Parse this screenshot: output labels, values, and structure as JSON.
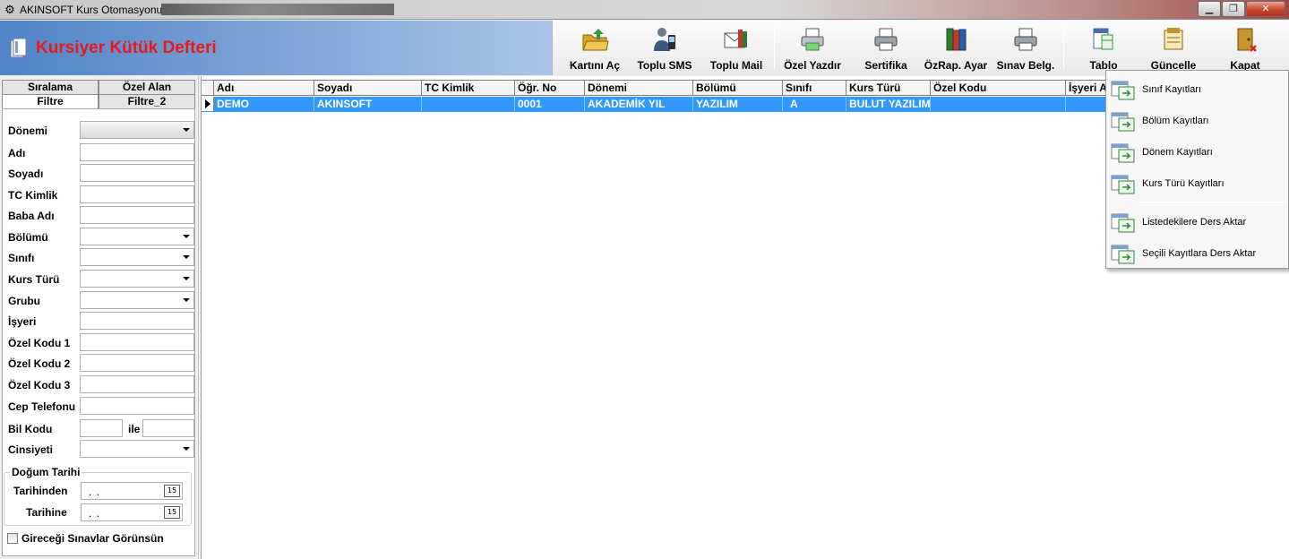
{
  "window": {
    "title": "AKINSOFT Kurs Otomasyonu s",
    "controls": [
      "minimize",
      "maximize",
      "close"
    ]
  },
  "header": {
    "title": "Kursiyer Kütük Defteri"
  },
  "toolbar": {
    "buttons": [
      {
        "label": "Kartını Aç",
        "icon": "folder-open-icon"
      },
      {
        "label": "Toplu SMS",
        "icon": "phone-person-icon"
      },
      {
        "label": "Toplu Mail",
        "icon": "mail-books-icon"
      },
      {
        "label": "Özel Yazdır",
        "icon": "printer-green-icon"
      },
      {
        "label": "Sertifika",
        "icon": "printer-icon"
      },
      {
        "label": "ÖzRap. Ayar",
        "icon": "books-icon"
      },
      {
        "label": "Sınav Belg.",
        "icon": "printer-icon"
      },
      {
        "label": "Tablo",
        "icon": "table-icon"
      },
      {
        "label": "Güncelle",
        "icon": "update-icon"
      },
      {
        "label": "Kapat",
        "icon": "door-exit-icon"
      }
    ]
  },
  "left_panel": {
    "tabs_row1": [
      "Sıralama",
      "Özel Alan"
    ],
    "tabs_row2": [
      "Filtre",
      "Filtre_2"
    ],
    "active_tab": "Filtre",
    "fields": [
      {
        "label": "Dönemi",
        "type": "select"
      },
      {
        "label": "Adı",
        "type": "text"
      },
      {
        "label": "Soyadı",
        "type": "text"
      },
      {
        "label": "TC Kimlik",
        "type": "text"
      },
      {
        "label": "Baba Adı",
        "type": "text"
      },
      {
        "label": "Bölümü",
        "type": "select"
      },
      {
        "label": "Sınıfı",
        "type": "select"
      },
      {
        "label": "Kurs Türü",
        "type": "select"
      },
      {
        "label": "Grubu",
        "type": "select"
      },
      {
        "label": "İşyeri",
        "type": "text"
      },
      {
        "label": "Özel Kodu 1",
        "type": "text"
      },
      {
        "label": "Özel Kodu 2",
        "type": "text"
      },
      {
        "label": "Özel Kodu 3",
        "type": "text"
      },
      {
        "label": "Cep Telefonu",
        "type": "text"
      },
      {
        "label": "Bil Kodu",
        "type": "range",
        "between": "ile"
      },
      {
        "label": "Cinsiyeti",
        "type": "select"
      }
    ],
    "dob_group": {
      "title": "Doğum Tarihi",
      "from_label": "Tarihinden",
      "to_label": "Tarihine",
      "from_value": ". .",
      "to_value": ". .",
      "calendar_text": "15"
    },
    "checkbox": {
      "label": "Gireceği Sınavlar Görünsün",
      "checked": false
    }
  },
  "grid": {
    "columns": [
      "Adı",
      "Soyadı",
      "TC Kimlik",
      "Öğr. No",
      "Dönemi",
      "Bölümü",
      "Sınıfı",
      "Kurs Türü",
      "Özel Kodu",
      "İşyeri A"
    ],
    "rows": [
      [
        "DEMO",
        "AKINSOFT",
        "",
        "0001",
        "AKADEMİK YIL",
        "YAZILIM",
        "A",
        "BULUT YAZILIM",
        "",
        ""
      ]
    ],
    "selected_row": 0,
    "selection_color": "#3399ff"
  },
  "dropdown_menu": {
    "items": [
      {
        "label": "Sınıf Kayıtları",
        "icon": "records-window-icon"
      },
      {
        "label": "Bölüm Kayıtları",
        "icon": "records-window-icon"
      },
      {
        "label": "Dönem Kayıtları",
        "icon": "records-window-icon"
      },
      {
        "label": "Kurs Türü Kayıtları",
        "icon": "records-window-icon"
      },
      {
        "label": "Listedekilere Ders Aktar",
        "icon": "records-window-icon"
      },
      {
        "label": "Seçili Kayıtlara Ders Aktar",
        "icon": "records-window-icon"
      }
    ]
  },
  "colors": {
    "title_red": "#e8191a",
    "header_blue": "#4f83c8",
    "selection_blue": "#3399ff"
  }
}
